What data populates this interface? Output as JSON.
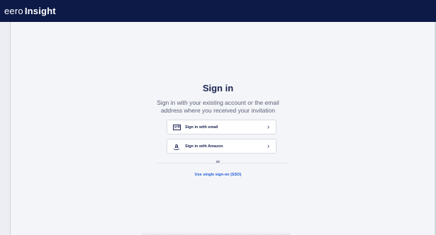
{
  "header": {
    "logo_light": "eero",
    "logo_bold": "Insight"
  },
  "signin": {
    "title": "Sign in",
    "subtitle_line1": "Sign in with your existing account or the email",
    "subtitle_line2": "address where you received your invitation",
    "email_button": {
      "label": "Sign in with email",
      "icon": "envelope-icon"
    },
    "amazon_button": {
      "label": "Sign in with Amazon",
      "icon": "amazon-logo-icon"
    },
    "or_label": "or",
    "sso_link": "Use single sign-on (SSO)"
  },
  "colors": {
    "topbar": "#0d1a47",
    "text_primary": "#1c2452",
    "link": "#2460d8",
    "page_bg": "#f4f5f8"
  }
}
